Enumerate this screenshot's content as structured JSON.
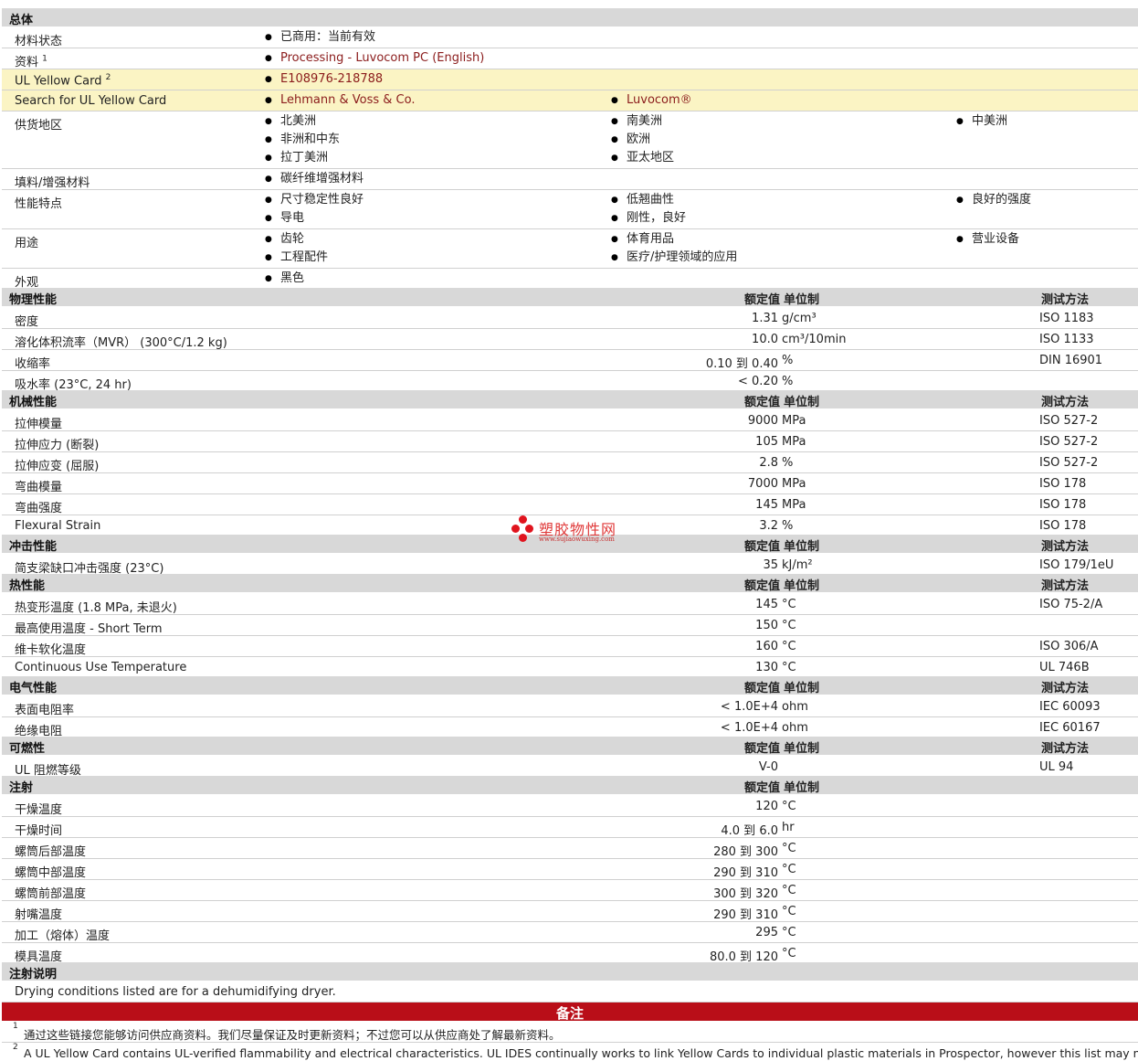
{
  "general": {
    "title": "总体",
    "rows": {
      "status": {
        "label": "材料状态",
        "c1": [
          "已商用：当前有效"
        ]
      },
      "docs": {
        "label": "资料",
        "sup": "1",
        "c1": [
          "Processing - Luvocom PC (English)"
        ]
      },
      "ulcard": {
        "label": "UL Yellow Card",
        "sup": "2",
        "c1": [
          "E108976-218788"
        ]
      },
      "search": {
        "label": "Search for UL Yellow Card",
        "c1": [
          "Lehmann & Voss & Co."
        ],
        "c2": [
          "Luvocom®"
        ]
      },
      "region": {
        "label": "供货地区",
        "c1": [
          "北美洲",
          "非洲和中东",
          "拉丁美洲"
        ],
        "c2": [
          "南美洲",
          "欧洲",
          "亚太地区"
        ],
        "c3": [
          "中美洲"
        ]
      },
      "filler": {
        "label": "填料/增强材料",
        "c1": [
          "碳纤维增强材料"
        ]
      },
      "features": {
        "label": "性能特点",
        "c1": [
          "尺寸稳定性良好",
          "导电"
        ],
        "c2": [
          "低翘曲性",
          "刚性，良好"
        ],
        "c3": [
          "良好的强度"
        ]
      },
      "uses": {
        "label": "用途",
        "c1": [
          "齿轮",
          "工程配件"
        ],
        "c2": [
          "体育用品",
          "医疗/护理领域的应用"
        ],
        "c3": [
          "营业设备"
        ]
      },
      "appearance": {
        "label": "外观",
        "c1": [
          "黑色"
        ]
      }
    }
  },
  "headers": {
    "nominal": "额定值",
    "unit": "单位制",
    "method": "测试方法"
  },
  "physical": {
    "title": "物理性能",
    "rows": [
      {
        "label": "密度",
        "value": "1.31",
        "unit": "g/cm³",
        "method": "ISO 1183"
      },
      {
        "label": "溶化体积流率（MVR） (300°C/1.2 kg)",
        "value": "10.0",
        "unit": "cm³/10min",
        "method": "ISO 1133"
      },
      {
        "label": "收缩率",
        "value": "0.10 到  0.40",
        "unit": "%",
        "method": "DIN 16901"
      },
      {
        "label": "吸水率 (23°C, 24 hr)",
        "value": "< 0.20",
        "unit": "%",
        "method": ""
      }
    ]
  },
  "mechanical": {
    "title": "机械性能",
    "rows": [
      {
        "label": "拉伸模量",
        "value": "9000",
        "unit": "MPa",
        "method": "ISO 527-2"
      },
      {
        "label": "拉伸应力 (断裂)",
        "value": "105",
        "unit": "MPa",
        "method": "ISO 527-2"
      },
      {
        "label": "拉伸应变 (屈服)",
        "value": "2.8",
        "unit": "%",
        "method": "ISO 527-2"
      },
      {
        "label": "弯曲模量",
        "value": "7000",
        "unit": "MPa",
        "method": "ISO 178"
      },
      {
        "label": "弯曲强度",
        "value": "145",
        "unit": "MPa",
        "method": "ISO 178"
      },
      {
        "label": "Flexural Strain",
        "value": "3.2",
        "unit": "%",
        "method": "ISO 178"
      }
    ]
  },
  "impact": {
    "title": "冲击性能",
    "rows": [
      {
        "label": "简支梁缺口冲击强度 (23°C)",
        "value": "35",
        "unit": "kJ/m²",
        "method": "ISO 179/1eU"
      }
    ]
  },
  "thermal": {
    "title": "热性能",
    "rows": [
      {
        "label": "热变形温度 (1.8 MPa, 未退火)",
        "value": "145",
        "unit": "°C",
        "method": "ISO 75-2/A"
      },
      {
        "label": "最高使用温度  - Short Term",
        "value": "150",
        "unit": "°C",
        "method": ""
      },
      {
        "label": "维卡软化温度",
        "value": "160",
        "unit": "°C",
        "method": "ISO 306/A"
      },
      {
        "label": "Continuous Use Temperature",
        "value": "130",
        "unit": "°C",
        "method": "UL 746B"
      }
    ]
  },
  "electrical": {
    "title": "电气性能",
    "rows": [
      {
        "label": "表面电阻率",
        "value": "< 1.0E+4",
        "unit": "ohm",
        "method": "IEC 60093"
      },
      {
        "label": "绝缘电阻",
        "value": "< 1.0E+4",
        "unit": "ohm",
        "method": "IEC 60167"
      }
    ]
  },
  "flammability": {
    "title": "可燃性",
    "rows": [
      {
        "label": "UL 阻燃等级",
        "value": "V-0",
        "unit": "",
        "method": "UL 94"
      }
    ]
  },
  "injection": {
    "title": "注射",
    "rows": [
      {
        "label": "干燥温度",
        "value": "120",
        "unit": "°C"
      },
      {
        "label": "干燥时间",
        "value": "4.0 到  6.0",
        "unit": "hr"
      },
      {
        "label": "螺筒后部温度",
        "value": "280 到  300",
        "unit": "°C"
      },
      {
        "label": "螺筒中部温度",
        "value": "290 到  310",
        "unit": "°C"
      },
      {
        "label": "螺筒前部温度",
        "value": "300 到  320",
        "unit": "°C"
      },
      {
        "label": "射嘴温度",
        "value": "290 到  310",
        "unit": "°C"
      },
      {
        "label": "加工（熔体）温度",
        "value": "295",
        "unit": "°C"
      },
      {
        "label": "模具温度",
        "value": "80.0 到  120",
        "unit": "°C"
      }
    ]
  },
  "injection_notes": {
    "title": "注射说明",
    "text": "Drying conditions listed are for a dehumidifying dryer."
  },
  "notes": {
    "title": "备注",
    "items": [
      {
        "n": "1",
        "text": "通过这些链接您能够访问供应商资料。我们尽量保证及时更新资料；不过您可以从供应商处了解最新资料。"
      },
      {
        "n": "2",
        "text": "A UL Yellow Card contains UL-verified flammability and electrical characteristics. UL IDES continually works to link Yellow Cards to individual plastic materials in Prospector, however this list may not include all of"
      }
    ]
  },
  "watermark": {
    "cn": "塑胶物性网",
    "url": "www.sujiaowuxing.com"
  }
}
